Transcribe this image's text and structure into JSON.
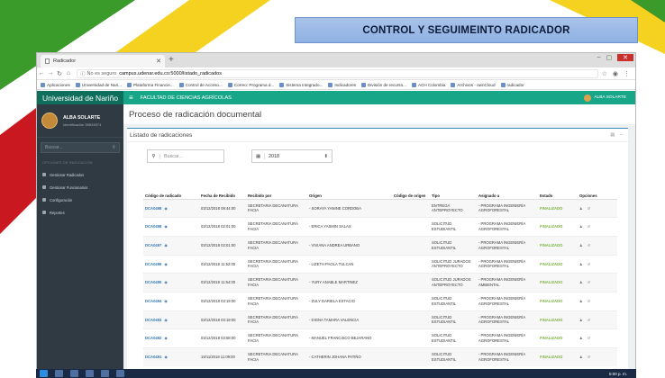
{
  "slide": {
    "banner_title": "CONTROL Y SEGUIMEINTO RADICADOR"
  },
  "browser": {
    "tab_title": "Radicador",
    "new_tab": "+",
    "url_prefix": "No es seguro",
    "url": "campus.udenar.edu.co:5000/listado_radicados",
    "window_controls": [
      "–",
      "▢",
      "✕"
    ],
    "bookmarks": [
      "Aplicaciones",
      "Universidad de Nari...",
      "Plataforma Financie...",
      "Control de Acceso...",
      "Correo: Programa d...",
      "Sistema Integrado...",
      "Indicadores",
      "División de recurso...",
      "ACH Colombia",
      "Archivos - ownCloud",
      "radicador"
    ]
  },
  "sidebar": {
    "brand": "Universidad de Nariño",
    "user_name": "ALBA SOLARTE",
    "user_id": "Identificación 59834574",
    "search_placeholder": "Buscar...",
    "section_label": "OPCIONES DE RADICACIÓN",
    "items": [
      {
        "label": "Gestionar Radicados",
        "icon": "edit-icon"
      },
      {
        "label": "Gestionar Funcionarios",
        "icon": "users-icon"
      },
      {
        "label": "Configuración",
        "icon": "gear-icon"
      },
      {
        "label": "Reportes",
        "icon": "chart-icon"
      }
    ]
  },
  "topbar": {
    "menu_icon": "≡",
    "faculty": "FACULTAD DE CIENCIAS AGRÍCOLAS",
    "user": "ALBA SOLARTE"
  },
  "page": {
    "title": "Proceso de radicación documental",
    "panel_title": "Listado de radicaciones"
  },
  "filters": {
    "search_placeholder": "Buscar...",
    "year": "2018"
  },
  "table": {
    "headers": [
      "Código de radicado",
      "Fecha de Recibido",
      "Recibido por",
      "Origen",
      "Código de origen",
      "Tipo",
      "Asignado a",
      "Estado",
      "Opciones"
    ],
    "rows": [
      {
        "code": "DCA0498",
        "date": "03/12/2018 08:44:00",
        "received": "SECRETARIA DECANATURA FACIA",
        "origin": "- SORAYA YANINE CORDOBA",
        "ocode": "",
        "type": "ENTREGA ANTEPROYECTO",
        "assigned": "- PROGRAMA INGENIERÍA AGROFORESTAL",
        "status": "FINALIZADO"
      },
      {
        "code": "DCA0498",
        "date": "03/12/2018 02:01:00",
        "received": "SECRETARIA DECANATURA FACIA",
        "origin": "- ERICA YASMIN SALAS",
        "ocode": "",
        "type": "SOLICITUD ESTUDIANTIL",
        "assigned": "- PROGRAMA INGENIERÍA AGROFORESTAL",
        "status": "FINALIZADO"
      },
      {
        "code": "DCA0497",
        "date": "03/12/2018 02:01:00",
        "received": "SECRETARIA DECANATURA FACIA",
        "origin": "- VIVIANA ANDREA URBANO",
        "ocode": "",
        "type": "SOLICITUD ESTUDIANTIL",
        "assigned": "- PROGRAMA INGENIERÍA AGROFORESTAL",
        "status": "FINALIZADO"
      },
      {
        "code": "DCA0496",
        "date": "03/12/2018 11:52:00",
        "received": "SECRETARIA DECANATURA FACIA",
        "origin": "- LIZETH PAOLA TULCAN",
        "ocode": "",
        "type": "SOLICITUD JURADOS ANTEPROYECTO",
        "assigned": "- PROGRAMA INGENIERÍA AGROFORESTAL",
        "status": "FINALIZADO"
      },
      {
        "code": "DCA0495",
        "date": "03/12/2018 11:54:00",
        "received": "SECRETARIA DECANATURA FACIA",
        "origin": "- YURY ANABLE MARTINEZ",
        "ocode": "",
        "type": "SOLICITUD JURADOS ANTEPROYECTO",
        "assigned": "- PROGRAMA INGENIERÍA AMBIENTAL",
        "status": "FINALIZADO"
      },
      {
        "code": "DCA0494",
        "date": "03/12/2018 03:19:00",
        "received": "SECRETARIA DECANATURA FACIA",
        "origin": "- ZULY DARIELA ESTACIO",
        "ocode": "",
        "type": "SOLICITUD ESTUDIANTIL",
        "assigned": "- PROGRAMA INGENIERÍA AGROFORESTAL",
        "status": "FINALIZADO"
      },
      {
        "code": "DCA0493",
        "date": "03/12/2018 03:19:00",
        "received": "SECRETARIA DECANATURA FACIA",
        "origin": "- DIGNA TAMARA VALENCIA",
        "ocode": "",
        "type": "SOLICITUD ESTUDIANTIL",
        "assigned": "- PROGRAMA INGENIERÍA AGROFORESTAL",
        "status": "FINALIZADO"
      },
      {
        "code": "DCA0492",
        "date": "03/12/2018 03:58:00",
        "received": "SECRETARIA DECANATURA FACIA",
        "origin": "- MANUEL FRANCISCO BEJARANO",
        "ocode": "",
        "type": "SOLICITUD ESTUDIANTIL",
        "assigned": "- PROGRAMA INGENIERÍA AGROFORESTAL",
        "status": "FINALIZADO"
      },
      {
        "code": "DCA0491",
        "date": "19/11/2018 11:09:00",
        "received": "SECRETARIA DECANATURA FACIA",
        "origin": "- CATHERIN JOHANA PATIÑO",
        "ocode": "",
        "type": "SOLICITUD ESTUDIANTIL",
        "assigned": "- PROGRAMA INGENIERÍA AGROFORESTAL",
        "status": "FINALIZADO"
      }
    ]
  },
  "taskbar": {
    "clock": "5:00 p. m."
  },
  "colors": {
    "sidebar": "#2f3a42",
    "topbar": "#18a689",
    "brand": "#0f6e5c",
    "status_done": "#7cb342",
    "banner": "#9fbbe7"
  }
}
